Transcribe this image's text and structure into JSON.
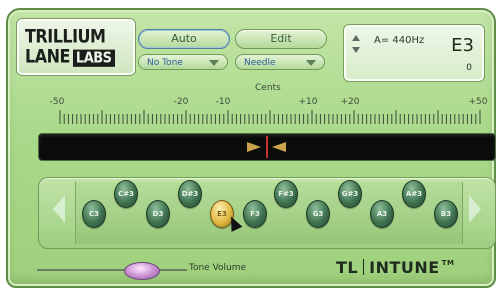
{
  "logo": {
    "line1": "TRILLIUM",
    "line2": "LANE",
    "badge": "LABS"
  },
  "controls": {
    "auto_label": "Auto",
    "edit_label": "Edit",
    "tone_select": "No Tone",
    "needle_select": "Needle"
  },
  "display": {
    "reference": "A= 440Hz",
    "note": "E3",
    "cents_value": "0"
  },
  "meter": {
    "title": "Cents",
    "scale": [
      "-50",
      "-20",
      "-10",
      "+10",
      "+20",
      "+50"
    ],
    "needle_cents": 0
  },
  "keyboard": {
    "lower": [
      "C3",
      "D3",
      "E3",
      "F3",
      "G3",
      "A3",
      "B3"
    ],
    "upper": [
      "C#3",
      "D#3",
      "F#3",
      "G#3",
      "A#3"
    ],
    "active": "E3"
  },
  "volume": {
    "label": "Tone Volume",
    "level": 0.62
  },
  "brand": {
    "prefix": "TL",
    "name": "INTUNE",
    "tm": "TM"
  },
  "colors": {
    "panel": "#a9d98a",
    "key": "#3f7350",
    "key_active": "#e0b842",
    "needle": "#c9a24a",
    "center_line": "#c0362c",
    "knob": "#c78bd0"
  }
}
